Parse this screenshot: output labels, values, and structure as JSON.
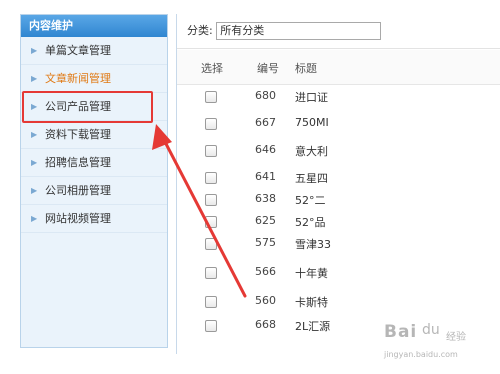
{
  "sidebar": {
    "title": "内容维护",
    "items": [
      {
        "label": "单篇文章管理",
        "active": false
      },
      {
        "label": "文章新闻管理",
        "active": true
      },
      {
        "label": "公司产品管理",
        "active": false,
        "highlighted": true
      },
      {
        "label": "资料下载管理",
        "active": false
      },
      {
        "label": "招聘信息管理",
        "active": false
      },
      {
        "label": "公司相册管理",
        "active": false
      },
      {
        "label": "网站视频管理",
        "active": false
      }
    ]
  },
  "filter": {
    "label": "分类:",
    "value": "所有分类"
  },
  "table": {
    "headers": {
      "select": "选择",
      "number": "编号",
      "title": "标题"
    },
    "rows": [
      {
        "number": "680",
        "title": "进口证"
      },
      {
        "number": "667",
        "title": "750MI"
      },
      {
        "number": "646",
        "title": "意大利"
      },
      {
        "number": "641",
        "title": "五星四"
      },
      {
        "number": "638",
        "title": "52°二"
      },
      {
        "number": "625",
        "title": "52°品"
      },
      {
        "number": "575",
        "title": "雪津33"
      },
      {
        "number": "566",
        "title": "十年黄"
      },
      {
        "number": "560",
        "title": "卡斯特"
      },
      {
        "number": "668",
        "title": "2L汇源"
      }
    ]
  },
  "watermark": {
    "brand": "Bai",
    "paw": "du",
    "sub": "经验",
    "url": "jingyan.baidu.com"
  },
  "colors": {
    "accent": "#2f86d1",
    "active_item": "#e07a15",
    "annotation": "#e53935"
  }
}
